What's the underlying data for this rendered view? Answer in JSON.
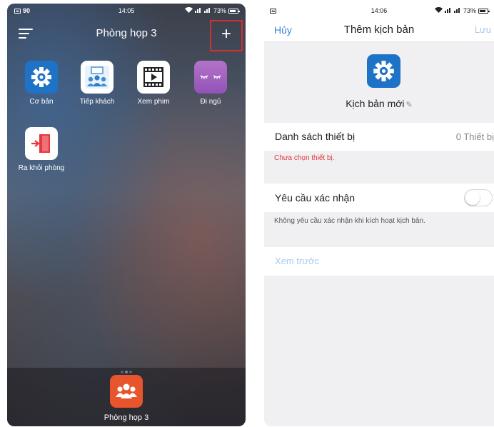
{
  "left_screen": {
    "status_bar": {
      "left_text": "90",
      "time": "14:05",
      "battery": "73%"
    },
    "title": "Phòng họp 3",
    "add_label": "+",
    "apps": [
      {
        "label": "Cơ bản",
        "icon": "gear-icon"
      },
      {
        "label": "Tiếp khách",
        "icon": "meeting-icon"
      },
      {
        "label": "Xem phim",
        "icon": "film-icon"
      },
      {
        "label": "Đi ngủ",
        "icon": "sleep-icon"
      },
      {
        "label": "Ra khỏi phòng",
        "icon": "exit-door-icon"
      }
    ],
    "dock": {
      "label": "Phòng họp 3",
      "icon": "group-icon"
    }
  },
  "right_screen": {
    "status_bar": {
      "time": "14:06",
      "battery": "73%"
    },
    "nav": {
      "cancel": "Hủy",
      "title": "Thêm kịch bản",
      "save": "Lưu"
    },
    "scene": {
      "name": "Kịch bản mới",
      "icon": "gear-icon"
    },
    "device_list": {
      "label": "Danh sách thiết bị",
      "value": "0 Thiết bị"
    },
    "device_error": "Chưa chọn thiết bị.",
    "confirm": {
      "label": "Yêu cầu xác nhận",
      "enabled": false
    },
    "confirm_note": "Không yêu cầu xác nhận khi kích hoạt kịch bản.",
    "preview": "Xem trước"
  },
  "colors": {
    "accent_blue": "#3a82d6",
    "error_red": "#e0363a",
    "icon_blue": "#1e73c7",
    "highlight_red": "#d0302f",
    "dock_orange": "#e8552c"
  }
}
